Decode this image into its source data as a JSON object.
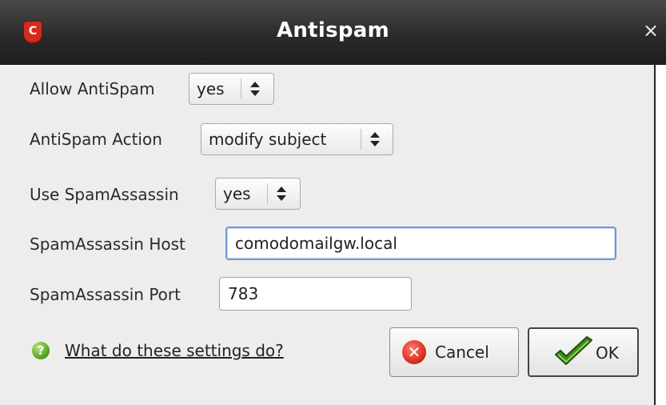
{
  "window": {
    "title": "Antispam",
    "logo_letter": "C",
    "close_glyph": "×"
  },
  "form": {
    "allow_antispam": {
      "label": "Allow AntiSpam",
      "value": "yes"
    },
    "antispam_action": {
      "label": "AntiSpam Action",
      "value": "modify subject"
    },
    "use_spamassassin": {
      "label": "Use SpamAssassin",
      "value": "yes"
    },
    "spamassassin_host": {
      "label": "SpamAssassin Host",
      "value": "comodomailgw.local"
    },
    "spamassassin_port": {
      "label": "SpamAssassin Port",
      "value": "783"
    }
  },
  "footer": {
    "help_glyph": "?",
    "help_link": "What do these settings do?",
    "cancel_glyph": "✕",
    "cancel_label": "Cancel",
    "ok_label": "OK"
  },
  "icons": {
    "logo": "comodo-shield-icon",
    "close": "close-icon",
    "help": "help-icon",
    "cancel": "cancel-icon",
    "ok": "checkmark-icon",
    "select_arrows": "updown-arrows-icon"
  },
  "colors": {
    "titlebar": "#2b2b2b",
    "dialog_bg": "#eeedeb",
    "focus_border": "#6f9ad3",
    "logo_red": "#d42b1e",
    "help_green": "#4d9d1a",
    "ok_green": "#3f8a1f"
  }
}
